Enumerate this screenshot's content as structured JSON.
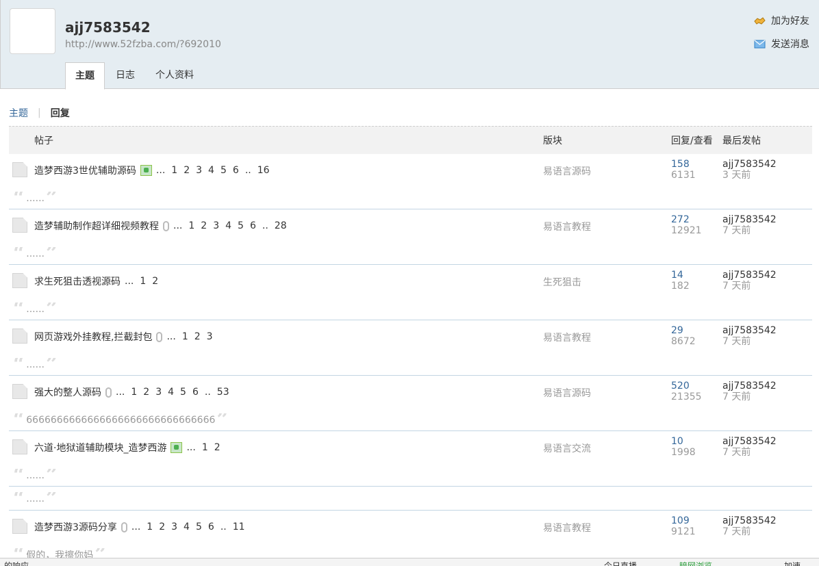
{
  "profile": {
    "username": "ajj7583542",
    "url": "http://www.52fzba.com/?692010",
    "add_friend": "加为好友",
    "send_message": "发送消息"
  },
  "tabs": [
    "主题",
    "日志",
    "个人资料"
  ],
  "subnav": {
    "threads": "主题",
    "replies": "回复"
  },
  "columns": {
    "post": "帖子",
    "forum": "版块",
    "replies_views": "回复/查看",
    "last_post": "最后发帖"
  },
  "rows": [
    {
      "title": "造梦西游3世优辅助源码",
      "attach": "image",
      "pages": [
        "...",
        "1",
        "2",
        "3",
        "4",
        "5",
        "6",
        "..",
        "16"
      ],
      "forum": "易语言源码",
      "replies": "158",
      "views": "6131",
      "last_by": "ajj7583542",
      "last_time": "3 天前",
      "quote": "......"
    },
    {
      "title": "造梦辅助制作超详细视频教程",
      "attach": "clip",
      "pages": [
        "...",
        "1",
        "2",
        "3",
        "4",
        "5",
        "6",
        "..",
        "28"
      ],
      "forum": "易语言教程",
      "replies": "272",
      "views": "12921",
      "last_by": "ajj7583542",
      "last_time": "7 天前",
      "quote": "......"
    },
    {
      "title": "求生死狙击透视源码",
      "attach": "",
      "pages": [
        "...",
        "1",
        "2"
      ],
      "forum": "生死狙击",
      "replies": "14",
      "views": "182",
      "last_by": "ajj7583542",
      "last_time": "7 天前",
      "quote": "......"
    },
    {
      "title": "网页游戏外挂教程,拦截封包",
      "attach": "clip",
      "pages": [
        "...",
        "1",
        "2",
        "3"
      ],
      "forum": "易语言教程",
      "replies": "29",
      "views": "8672",
      "last_by": "ajj7583542",
      "last_time": "7 天前",
      "quote": "......"
    },
    {
      "title": "强大的整人源码",
      "attach": "clip",
      "pages": [
        "...",
        "1",
        "2",
        "3",
        "4",
        "5",
        "6",
        "..",
        "53"
      ],
      "forum": "易语言源码",
      "replies": "520",
      "views": "21355",
      "last_by": "ajj7583542",
      "last_time": "7 天前",
      "quote": "6666666666666666666666666666666"
    },
    {
      "title": "六道·地狱道辅助模块_造梦西游",
      "attach": "image",
      "pages": [
        "...",
        "1",
        "2"
      ],
      "forum": "易语言交流",
      "replies": "10",
      "views": "1998",
      "last_by": "ajj7583542",
      "last_time": "7 天前",
      "quote": "......"
    }
  ],
  "orphan_quote": "......",
  "last_row": {
    "title": "造梦西游3源码分享",
    "attach": "clip",
    "pages": [
      "...",
      "1",
      "2",
      "3",
      "4",
      "5",
      "6",
      "..",
      "11"
    ],
    "forum": "易语言教程",
    "replies": "109",
    "views": "9121",
    "last_by": "ajj7583542",
    "last_time": "7 天前",
    "quote": "假的，我擦你妈"
  },
  "statusbar": {
    "left": "的响应",
    "live": "今日直播",
    "reader": "暗网浏览",
    "speed": "加速"
  }
}
